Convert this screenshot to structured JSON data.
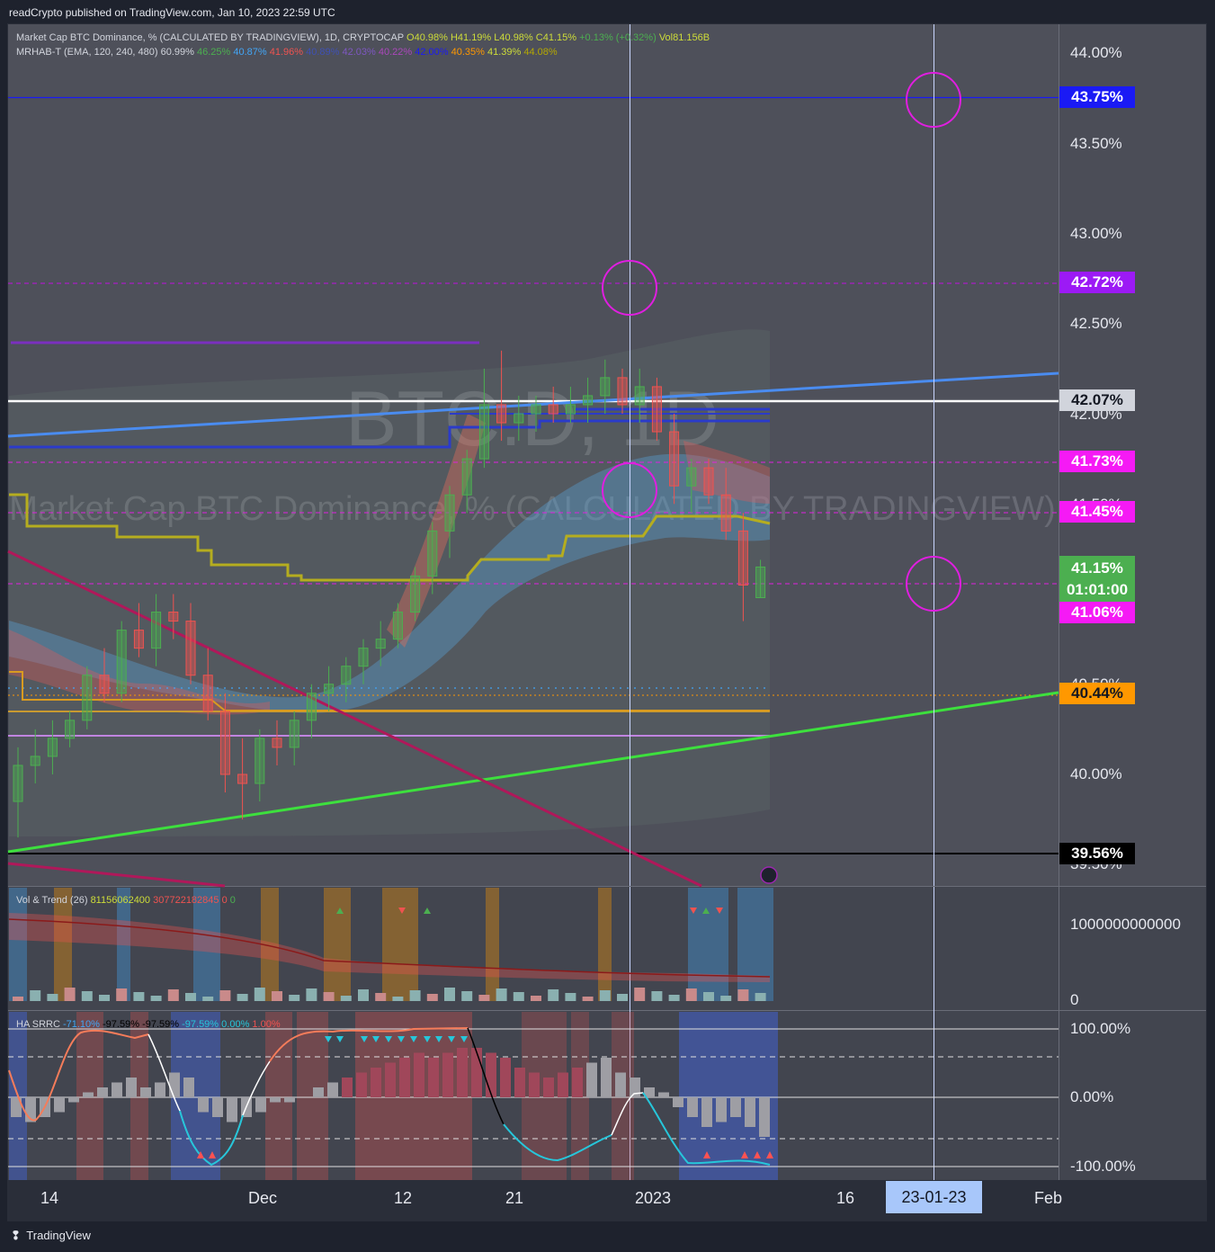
{
  "header": {
    "published": "readCrypto published on TradingView.com, Jan 10, 2023 22:59 UTC"
  },
  "legend": {
    "main": "Market Cap BTC Dominance, % (CALCULATED BY TRADINGVIEW), 1D, CRYPTOCAP",
    "ohlc": {
      "o": "O40.98%",
      "h": "H41.19%",
      "l": "L40.98%",
      "c": "C41.15%",
      "chg": "+0.13%",
      "chg_pct": "(+0.32%)",
      "vol": "Vol81.156B"
    },
    "mrhab": {
      "name": "MRHAB-T (EMA, 120, 240, 480)",
      "v1": "60.99%",
      "v2": "46.25%",
      "v3": "40.87%",
      "v4": "41.96%",
      "v5": "40.89%",
      "v6": "42.03%",
      "v7": "40.22%",
      "v8": "42.00%",
      "v9": "40.35%",
      "v10": "41.39%",
      "v11": "44.08%"
    },
    "watermark_symbol": "BTC.D, 1D",
    "watermark_name": "Market Cap BTC Dominance, % (CALCULATED BY TRADINGVIEW)"
  },
  "price_axis": {
    "ticks": [
      "44.00%",
      "43.50%",
      "43.00%",
      "42.50%",
      "42.00%",
      "41.50%",
      "40.50%",
      "40.00%",
      "39.50%"
    ]
  },
  "price_tags": [
    {
      "text": "43.75%",
      "bg": "#1a1af5",
      "fg": "#ffffff"
    },
    {
      "text": "42.72%",
      "bg": "#9c1af5",
      "fg": "#ffffff"
    },
    {
      "text": "42.07%",
      "bg": "#d1d4dc",
      "fg": "#131722"
    },
    {
      "text": "41.73%",
      "bg": "#f51af5",
      "fg": "#ffffff"
    },
    {
      "text": "41.45%",
      "bg": "#f51af5",
      "fg": "#ffffff"
    },
    {
      "text": "41.15%",
      "bg": "#4caf50",
      "fg": "#ffffff"
    },
    {
      "text": "41.06%",
      "bg": "#f51af5",
      "fg": "#ffffff"
    },
    {
      "text": "40.44%",
      "bg": "#ff9800",
      "fg": "#131722"
    },
    {
      "text": "39.56%",
      "bg": "#000000",
      "fg": "#ffffff"
    }
  ],
  "countdown": "01:01:00",
  "vol_panel": {
    "title": "Vol & Trend (26)",
    "v1": "81156062400",
    "v2": "307722182845",
    "v3": "0",
    "v4": "0",
    "axis_top": "1000000000000",
    "axis_bottom": "0"
  },
  "osc_panel": {
    "title": "HA SRRC",
    "v1": "-71.10%",
    "v2": "-97.59%",
    "v3": "-97.59%",
    "v4": "-97.59%",
    "v5": "0.00%",
    "v6": "1.00%",
    "axis": [
      "100.00%",
      "0.00%",
      "-100.00%"
    ]
  },
  "time_axis": {
    "ticks": [
      "14",
      "Dec",
      "12",
      "21",
      "2023",
      "16",
      "Feb"
    ],
    "cursor_label": "23-01-23"
  },
  "footer": {
    "brand": "TradingView"
  },
  "chart_data": {
    "type": "candlestick",
    "symbol": "BTC.D",
    "interval": "1D",
    "ylim": [
      39.5,
      44.2
    ],
    "levels": [
      43.75,
      42.72,
      42.07,
      41.73,
      41.45,
      41.06,
      40.44,
      39.56
    ],
    "last_price": 41.15,
    "candles": [
      [
        39.85,
        40.15,
        39.65,
        40.05
      ],
      [
        40.05,
        40.25,
        39.95,
        40.1
      ],
      [
        40.1,
        40.3,
        40.0,
        40.2
      ],
      [
        40.2,
        40.35,
        40.15,
        40.3
      ],
      [
        40.3,
        40.6,
        40.25,
        40.55
      ],
      [
        40.55,
        40.7,
        40.4,
        40.45
      ],
      [
        40.45,
        40.85,
        40.4,
        40.8
      ],
      [
        40.8,
        40.95,
        40.65,
        40.7
      ],
      [
        40.7,
        41.0,
        40.6,
        40.9
      ],
      [
        40.9,
        41.0,
        40.75,
        40.85
      ],
      [
        40.85,
        40.95,
        40.5,
        40.55
      ],
      [
        40.55,
        40.7,
        40.3,
        40.35
      ],
      [
        40.35,
        40.45,
        39.9,
        40.0
      ],
      [
        40.0,
        40.2,
        39.75,
        39.95
      ],
      [
        39.95,
        40.25,
        39.85,
        40.2
      ],
      [
        40.2,
        40.3,
        40.05,
        40.15
      ],
      [
        40.15,
        40.35,
        40.05,
        40.3
      ],
      [
        40.3,
        40.5,
        40.2,
        40.45
      ],
      [
        40.45,
        40.6,
        40.35,
        40.5
      ],
      [
        40.5,
        40.65,
        40.4,
        40.6
      ],
      [
        40.6,
        40.75,
        40.5,
        40.7
      ],
      [
        40.7,
        40.85,
        40.6,
        40.75
      ],
      [
        40.75,
        40.95,
        40.7,
        40.9
      ],
      [
        40.9,
        41.15,
        40.85,
        41.1
      ],
      [
        41.1,
        41.4,
        41.0,
        41.35
      ],
      [
        41.35,
        41.6,
        41.2,
        41.55
      ],
      [
        41.55,
        41.8,
        41.45,
        41.75
      ],
      [
        41.75,
        42.25,
        41.7,
        42.05
      ],
      [
        42.05,
        42.35,
        41.85,
        41.95
      ],
      [
        41.95,
        42.1,
        41.85,
        42.0
      ],
      [
        42.0,
        42.1,
        41.9,
        42.05
      ],
      [
        42.05,
        42.15,
        41.95,
        42.0
      ],
      [
        42.0,
        42.15,
        41.95,
        42.05
      ],
      [
        42.05,
        42.2,
        41.95,
        42.1
      ],
      [
        42.1,
        42.3,
        42.0,
        42.2
      ],
      [
        42.2,
        42.25,
        42.0,
        42.05
      ],
      [
        42.05,
        42.25,
        41.95,
        42.15
      ],
      [
        42.15,
        42.2,
        41.85,
        41.9
      ],
      [
        41.9,
        42.0,
        41.5,
        41.6
      ],
      [
        41.6,
        41.75,
        41.45,
        41.7
      ],
      [
        41.7,
        41.75,
        41.5,
        41.55
      ],
      [
        41.55,
        41.7,
        41.3,
        41.35
      ],
      [
        41.35,
        41.45,
        40.85,
        41.05
      ],
      [
        40.98,
        41.19,
        40.98,
        41.15
      ]
    ]
  }
}
